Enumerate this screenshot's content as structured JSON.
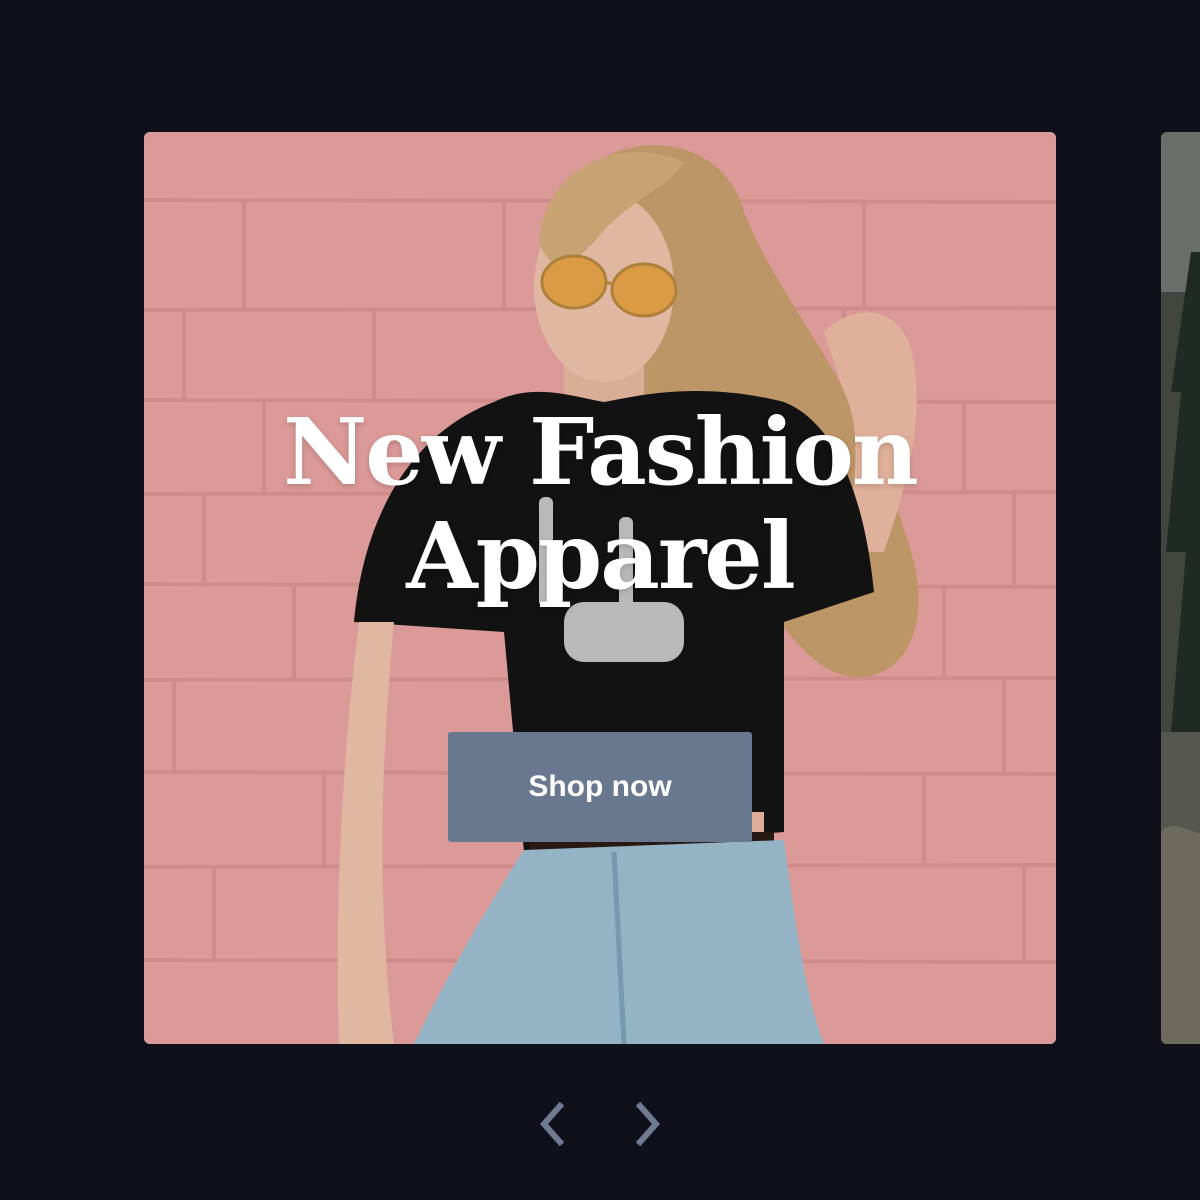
{
  "hero": {
    "headline": "New Fashion Apparel",
    "cta_label": "Shop now"
  },
  "carousel": {
    "prev_icon": "chevron-left-icon",
    "next_icon": "chevron-right-icon"
  },
  "colors": {
    "background": "#0f101a",
    "cta": "#6a788f",
    "arrow": "#6f7b92",
    "headline": "#ffffff"
  }
}
